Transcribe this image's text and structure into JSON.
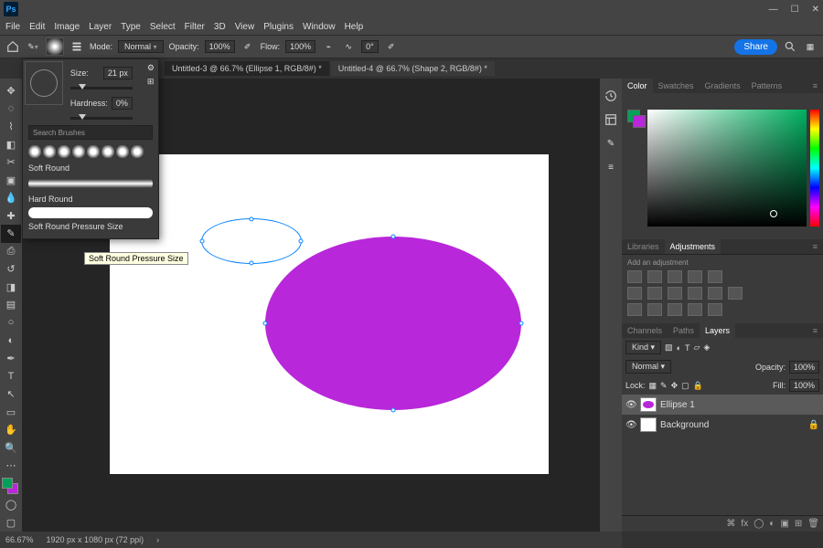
{
  "titlebar": {
    "app": "Ps"
  },
  "menu": [
    "File",
    "Edit",
    "Image",
    "Layer",
    "Type",
    "Select",
    "Filter",
    "3D",
    "View",
    "Plugins",
    "Window",
    "Help"
  ],
  "options": {
    "mode_label": "Mode:",
    "mode_value": "Normal",
    "opacity_label": "Opacity:",
    "opacity_value": "100%",
    "flow_label": "Flow:",
    "flow_value": "100%",
    "angle_value": "0°",
    "share": "Share"
  },
  "tabs": [
    {
      "label": "Untitled-3 @ 66.7% (Ellipse 1, RGB/8#) *",
      "active": true
    },
    {
      "label": "Untitled-4 @ 66.7% (Shape 2, RGB/8#) *",
      "active": false
    }
  ],
  "brush_popover": {
    "size_label": "Size:",
    "size_value": "21 px",
    "hardness_label": "Hardness:",
    "hardness_value": "0%",
    "search_placeholder": "Search Brushes",
    "presets": [
      "Soft Round",
      "Hard Round",
      "Soft Round Pressure Size"
    ],
    "tooltip": "Soft Round Pressure Size"
  },
  "right_panels": {
    "color_tabs": [
      "Color",
      "Swatches",
      "Gradients",
      "Patterns"
    ],
    "lib_tabs": [
      "Libraries",
      "Adjustments"
    ],
    "adjustments_hint": "Add an adjustment",
    "chan_tabs": [
      "Channels",
      "Paths",
      "Layers"
    ],
    "layers": {
      "kind": "Kind",
      "blend": "Normal",
      "opacity_label": "Opacity:",
      "opacity": "100%",
      "lock_label": "Lock:",
      "fill_label": "Fill:",
      "fill": "100%",
      "items": [
        {
          "name": "Ellipse 1",
          "selected": true,
          "thumb": "ellipse"
        },
        {
          "name": "Background",
          "selected": false,
          "thumb": "white",
          "locked": true
        }
      ]
    }
  },
  "status": {
    "zoom": "66.67%",
    "doc": "1920 px x 1080 px (72 ppi)"
  },
  "colors": {
    "accent": "#1473e6",
    "shape": "#b827d9",
    "fg": "#00a158"
  }
}
